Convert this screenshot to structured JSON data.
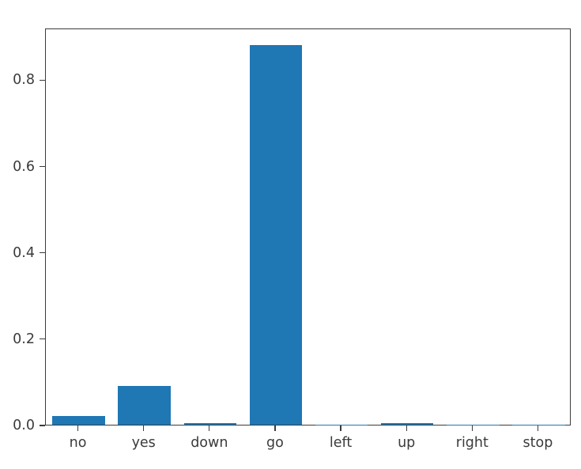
{
  "chart_data": {
    "type": "bar",
    "title": "",
    "xlabel": "",
    "ylabel": "",
    "categories": [
      "no",
      "yes",
      "down",
      "go",
      "left",
      "up",
      "right",
      "stop"
    ],
    "values": [
      0.021,
      0.09,
      0.004,
      0.88,
      0.0005,
      0.0045,
      0.0004,
      0.0003
    ],
    "ylim": [
      0.0,
      0.92
    ],
    "xlim": [
      -0.5,
      7.5
    ],
    "yticks": [
      0.0,
      0.2,
      0.4,
      0.6,
      0.8
    ],
    "ytick_labels": [
      "0.0",
      "0.2",
      "0.4",
      "0.6",
      "0.8"
    ],
    "grid": false,
    "legend": null,
    "legend_position": "none",
    "bar_color": "#1f77b4",
    "bar_width_fraction": 0.8
  },
  "figure": {
    "background_color": "#ffffff",
    "axes_edge_color": "#3b3b3b",
    "tick_color": "#3b3b3b",
    "tick_label_color": "#3b3b3b"
  }
}
